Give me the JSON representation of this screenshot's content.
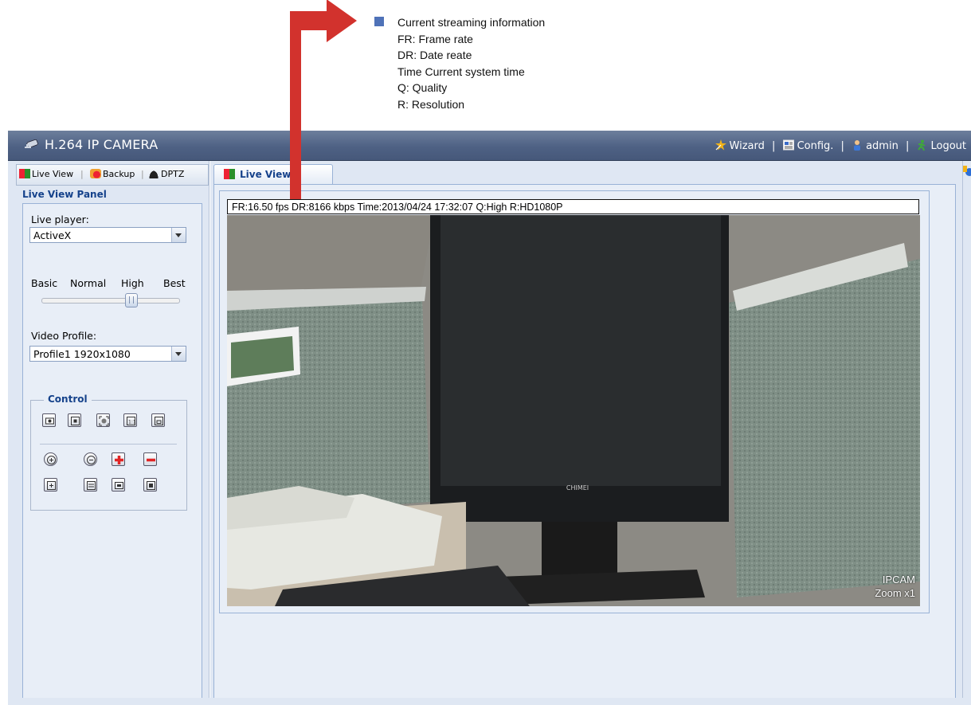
{
  "annotation": {
    "lines": [
      "Current streaming information",
      "FR: Frame rate",
      "DR: Date reate",
      "Time Current system time",
      "Q: Quality",
      "R: Resolution"
    ],
    "marker_color": "#4f72b8",
    "arrow_color": "#d2322d"
  },
  "header": {
    "title": "H.264 IP CAMERA",
    "nav": {
      "wizard": "Wizard",
      "config": "Config.",
      "user": "admin",
      "logout": "Logout"
    }
  },
  "sidebar": {
    "tabs": [
      "Live View",
      "Backup",
      "DPTZ"
    ],
    "panel_title": "Live View Panel",
    "live_player_label": "Live player:",
    "live_player_value": "ActiveX",
    "quality_labels": [
      "Basic",
      "Normal",
      "High",
      "Best"
    ],
    "quality_level": "High",
    "video_profile_label": "Video Profile:",
    "video_profile_value": "Profile1 1920x1080",
    "control_legend": "Control"
  },
  "main": {
    "tab_label": "Live View",
    "info_text": "FR:16.50 fps  DR:8166 kbps Time:2013/04/24 17:32:07 Q:High R:HD1080P",
    "overlay_name": "IPCAM",
    "overlay_zoom": "Zoom x1",
    "monitor_brand": "CHIMEI"
  },
  "colors": {
    "header_bg": "#4e6184",
    "panel_bg": "#e8eef7",
    "title_blue": "#15428b"
  }
}
